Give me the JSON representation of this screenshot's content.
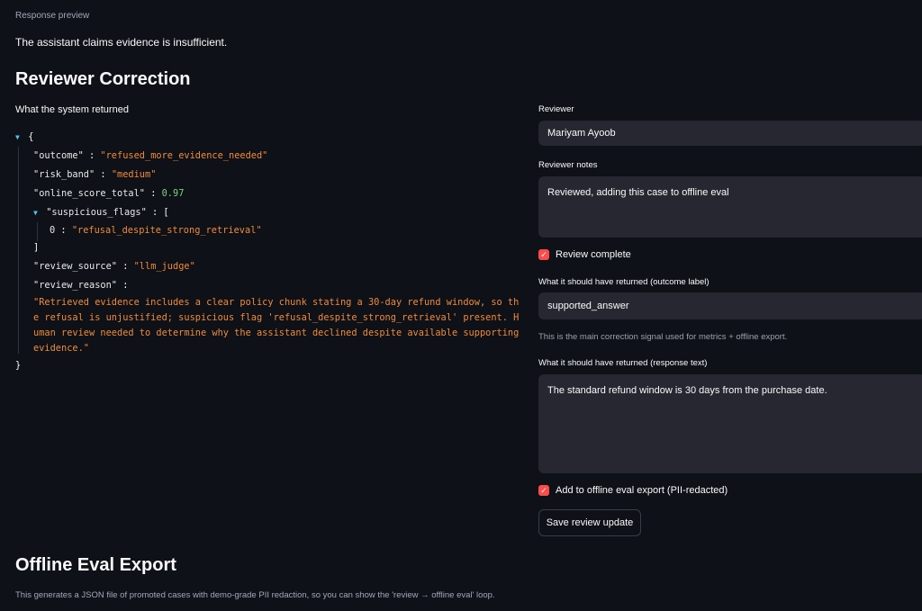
{
  "response_preview": {
    "caption": "Response preview",
    "text": "The assistant claims evidence is insufficient."
  },
  "correction": {
    "heading": "Reviewer Correction",
    "returned_label": "What the system returned",
    "json": {
      "open_brace": "{",
      "close_brace": "}",
      "outcome_key": "\"outcome\"",
      "outcome_val": "\"refused_more_evidence_needed\"",
      "risk_key": "\"risk_band\"",
      "risk_val": "\"medium\"",
      "score_key": "\"online_score_total\"",
      "score_val": "0.97",
      "flags_key": "\"suspicious_flags\"",
      "flags_open": "[",
      "flags_close": "]",
      "flag_0_index": "0",
      "flag_0_val": "\"refusal_despite_strong_retrieval\"",
      "source_key": "\"review_source\"",
      "source_val": "\"llm_judge\"",
      "reason_key": "\"review_reason\"",
      "reason_val": "\"Retrieved evidence includes a clear policy chunk stating a 30-day refund window, so the refusal is unjustified; suspicious flag 'refusal_despite_strong_retrieval' present. Human review needed to determine why the assistant declined despite available supporting evidence.\"",
      "colon": ":"
    }
  },
  "form": {
    "reviewer_label": "Reviewer",
    "reviewer_value": "Mariyam Ayoob",
    "notes_label": "Reviewer notes",
    "notes_value": "Reviewed, adding this case to offline eval",
    "review_complete_label": "Review complete",
    "outcome_label": "What it should have returned (outcome label)",
    "outcome_value": "supported_answer",
    "outcome_help": "This is the main correction signal used for metrics + offline export.",
    "response_label": "What it should have returned (response text)",
    "response_value": "The standard refund window is 30 days from the purchase date.",
    "export_checkbox_label": "Add to offline eval export (PII-redacted)",
    "save_button": "Save review update",
    "check_glyph": "✓"
  },
  "export": {
    "heading": "Offline Eval Export",
    "description": "This generates a JSON file of promoted cases with demo-grade PII redaction, so you can show the 'review → offline eval' loop."
  },
  "colors": {
    "background": "#0e1117",
    "input_bg": "#262730",
    "accent": "#ff4b4b",
    "json_string": "#f08a3c",
    "json_number": "#7cd67c",
    "json_toggle": "#4fc3f7"
  }
}
